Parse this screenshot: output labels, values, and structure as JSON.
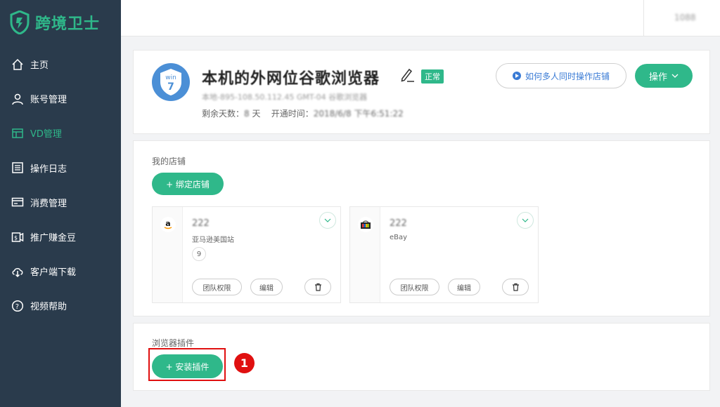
{
  "app": {
    "logo_text": "跨境卫士",
    "brand_color": "#2fb88a",
    "sidebar_color": "#2a3b4c"
  },
  "sidebar": {
    "items": [
      {
        "label": "主页",
        "icon": "home-icon"
      },
      {
        "label": "账号管理",
        "icon": "user-icon"
      },
      {
        "label": "VD管理",
        "icon": "window-icon",
        "active": true
      },
      {
        "label": "操作日志",
        "icon": "log-icon"
      },
      {
        "label": "消费管理",
        "icon": "card-icon"
      },
      {
        "label": "推广赚金豆",
        "icon": "coin-icon"
      },
      {
        "label": "客户端下载",
        "icon": "cloud-download-icon"
      },
      {
        "label": "视频帮助",
        "icon": "help-icon"
      }
    ]
  },
  "header": {
    "user": "1088"
  },
  "browser": {
    "os_badge_top": "win",
    "os_badge_bottom": "7",
    "name": "本机的外网位谷歌浏览器",
    "status": "正常",
    "meta": "本地-895-108.50.112.45 GMT-04 谷歌浏览器",
    "days_label": "剩余天数：",
    "days_value": "8",
    "days_unit": "天",
    "open_time_label": "开通时间：",
    "open_time_value": "2018/6/8 下午6:51:22",
    "howto_button": "如何多人同时操作店铺",
    "ops_button": "操作"
  },
  "shops": {
    "title": "我的店铺",
    "bind_button": "+ 绑定店铺",
    "items": [
      {
        "name": "222",
        "platform": "亚马逊美国站",
        "count": "9",
        "logo": "a",
        "team_btn": "团队权限",
        "edit_btn": "编辑"
      },
      {
        "name": "222",
        "platform": "eBay",
        "count": "",
        "logo": "ebay",
        "team_btn": "团队权限",
        "edit_btn": "编辑"
      }
    ]
  },
  "plugins": {
    "title": "浏览器插件",
    "install_button": "+ 安装插件"
  },
  "annotation": {
    "marker": "1"
  }
}
